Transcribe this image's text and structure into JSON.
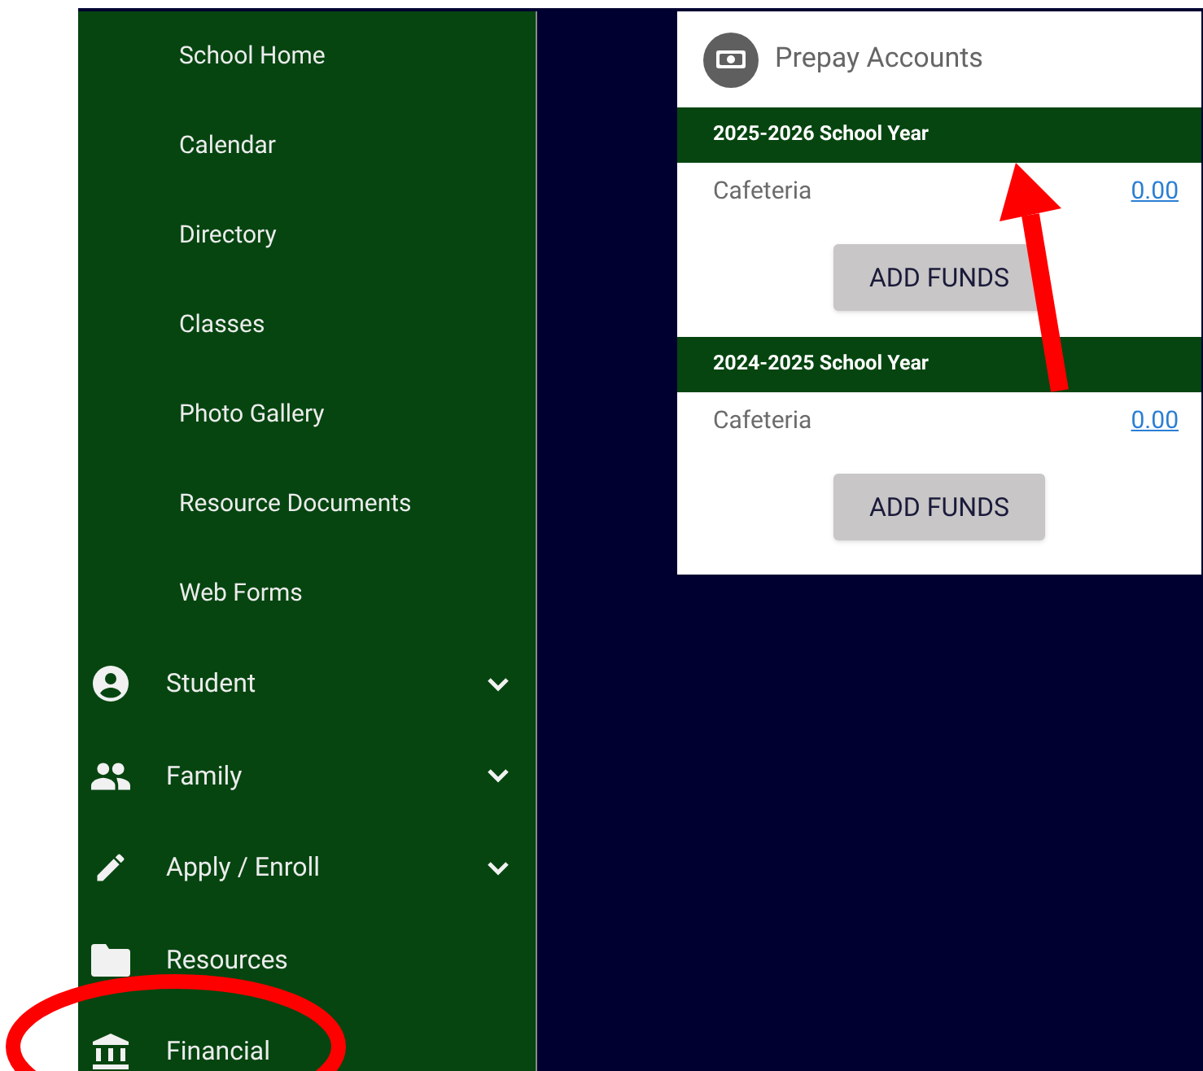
{
  "sidebar": {
    "subitems": [
      {
        "label": "School Home"
      },
      {
        "label": "Calendar"
      },
      {
        "label": "Directory"
      },
      {
        "label": "Classes"
      },
      {
        "label": "Photo Gallery"
      },
      {
        "label": "Resource Documents"
      },
      {
        "label": "Web Forms"
      }
    ],
    "items": [
      {
        "label": "Student",
        "expandable": true
      },
      {
        "label": "Family",
        "expandable": true
      },
      {
        "label": "Apply / Enroll",
        "expandable": true
      },
      {
        "label": "Resources",
        "expandable": false
      },
      {
        "label": "Financial",
        "expandable": false
      }
    ]
  },
  "card": {
    "title": "Prepay Accounts",
    "years": [
      {
        "heading": "2025-2026 School Year",
        "account": "Cafeteria",
        "balance": "0.00",
        "button": "ADD FUNDS"
      },
      {
        "heading": "2024-2025 School Year",
        "account": "Cafeteria",
        "balance": "0.00",
        "button": "ADD FUNDS"
      }
    ]
  }
}
